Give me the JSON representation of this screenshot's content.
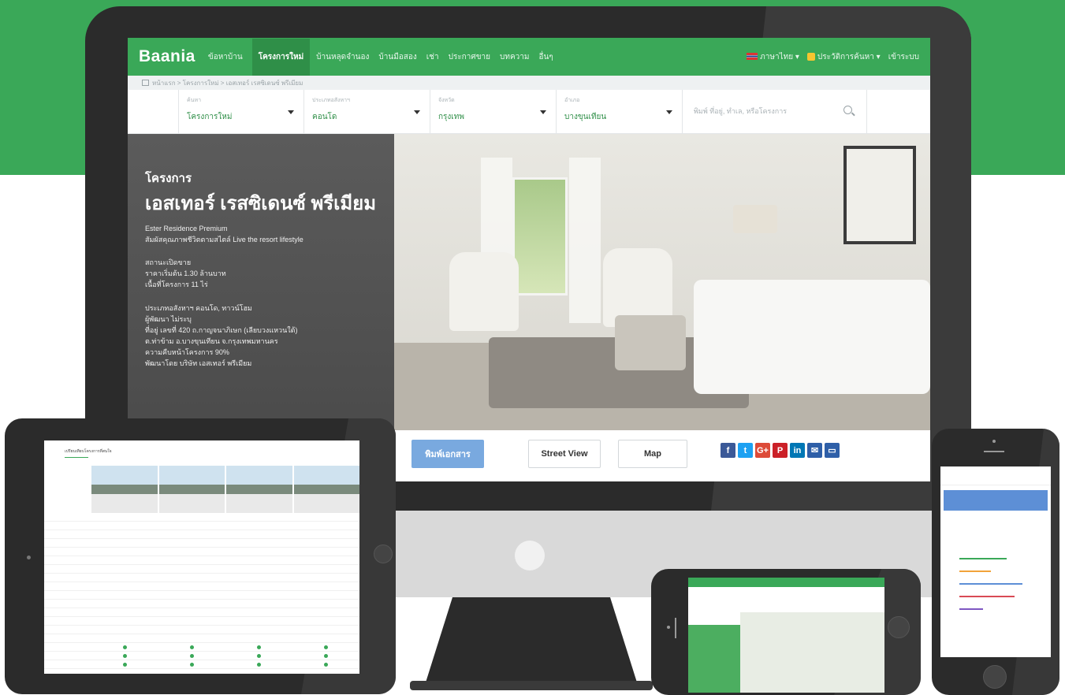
{
  "site": {
    "logo": "Baania",
    "nav": [
      {
        "label": "ข้อหาบ้าน",
        "active": false
      },
      {
        "label": "โครงการใหม่",
        "active": true
      },
      {
        "label": "บ้านหลุดจำนอง",
        "active": false
      },
      {
        "label": "บ้านมือสอง",
        "active": false
      },
      {
        "label": "เช่า",
        "active": false
      },
      {
        "label": "ประกาศขาย",
        "active": false
      },
      {
        "label": "บทความ",
        "active": false
      },
      {
        "label": "อื่นๆ",
        "active": false
      }
    ],
    "lang_label": "ภาษาไทย",
    "history_label": "ประวัติการค้นหา",
    "login_label": "เข้าระบบ"
  },
  "breadcrumb": "หน้าแรก > โครงการใหม่ > เอสเทอร์ เรสซิเดนซ์ พรีเมียม",
  "filters": [
    {
      "label": "ค้นหา",
      "value": "โครงการใหม่"
    },
    {
      "label": "ประเภทอสังหาฯ",
      "value": "คอนโด"
    },
    {
      "label": "จังหวัด",
      "value": "กรุงเทพ"
    },
    {
      "label": "อำเภอ",
      "value": "บางขุนเทียน"
    }
  ],
  "search": {
    "placeholder": "พิมพ์ ที่อยู่, ทำเล, หรือโครงการ"
  },
  "project": {
    "kicker": "โครงการ",
    "title": "เอสเทอร์ เรสซิเดนซ์ พรีเมียม",
    "name_en": "Ester Residence Premium",
    "tagline": "สัมผัสคุณภาพชีวิตตามสไตล์ Live the resort lifestyle",
    "block1": [
      "สถานะเปิดขาย",
      "ราคาเริ่มต้น 1.30 ล้านบาท",
      "เนื้อที่โครงการ 11 ไร่"
    ],
    "block2": [
      "ประเภทอสังหาฯ คอนโด, ทาวน์โฮม",
      "ผู้พัฒนา ไม่ระบุ",
      "ที่อยู่ เลขที่ 420 ถ.กาญจนาภิเษก (เลียบวงแหวนใต้)",
      "ต.ท่าข้าม อ.บางขุนเทียน จ.กรุงเทพมหานคร",
      "ความคืบหน้าโครงการ 90%",
      "พัฒนาโดย บริษัท เอสเทอร์ พรีเมียม"
    ]
  },
  "actions": {
    "print": "พิมพ์เอกสาร",
    "street_view": "Street View",
    "map": "Map"
  },
  "social": [
    {
      "icon": "facebook-icon",
      "glyph": "f",
      "color": "#3b5998"
    },
    {
      "icon": "twitter-icon",
      "glyph": "t",
      "color": "#1da1f2"
    },
    {
      "icon": "google-plus-icon",
      "glyph": "G+",
      "color": "#dd4b39"
    },
    {
      "icon": "pinterest-icon",
      "glyph": "P",
      "color": "#cb2027"
    },
    {
      "icon": "linkedin-icon",
      "glyph": "in",
      "color": "#0077b5"
    },
    {
      "icon": "email-icon",
      "glyph": "✉",
      "color": "#2e5fa8"
    },
    {
      "icon": "print-icon",
      "glyph": "▭",
      "color": "#2e5fa8"
    }
  ],
  "tablet": {
    "title": "เปรียบเทียบโครงการที่สนใจ"
  },
  "colors": {
    "brand_green": "#3aa858",
    "accent_blue": "#79a9df"
  }
}
